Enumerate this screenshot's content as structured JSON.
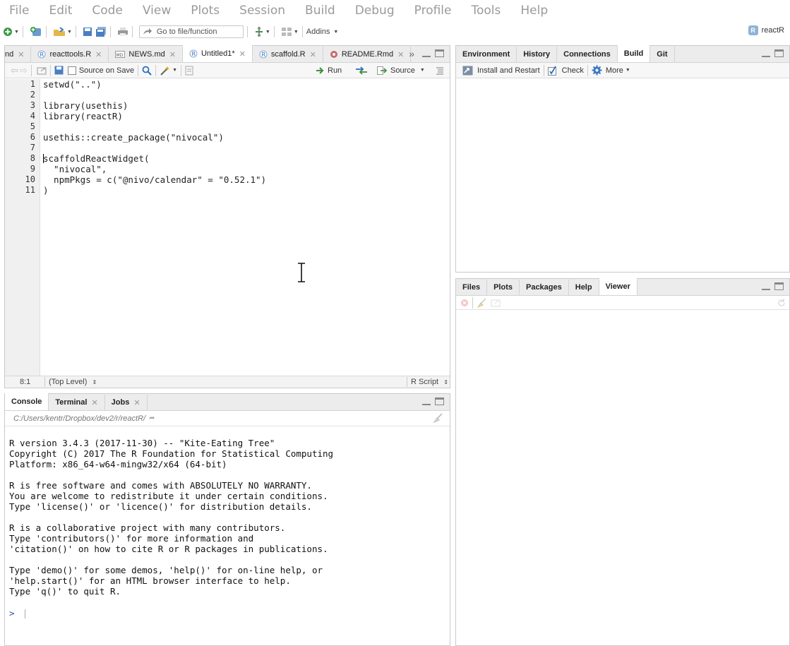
{
  "menu": [
    "File",
    "Edit",
    "Code",
    "View",
    "Plots",
    "Session",
    "Build",
    "Debug",
    "Profile",
    "Tools",
    "Help"
  ],
  "toolbar": {
    "goto_placeholder": "Go to file/function",
    "addins_label": "Addins",
    "project_label": "reactR",
    "project_icon": "R"
  },
  "source": {
    "tabs": [
      {
        "label": "nd",
        "closable": true,
        "active": false
      },
      {
        "label": "reacttools.R",
        "closable": true,
        "active": false
      },
      {
        "label": "NEWS.md",
        "closable": true,
        "active": false
      },
      {
        "label": "Untitled1*",
        "closable": true,
        "active": true
      },
      {
        "label": "scaffold.R",
        "closable": true,
        "active": false
      },
      {
        "label": "README.Rmd",
        "closable": true,
        "active": false
      }
    ],
    "source_on_save_label": "Source on Save",
    "run_label": "Run",
    "source_label": "Source",
    "line_numbers": [
      "1",
      "2",
      "3",
      "4",
      "5",
      "6",
      "7",
      "8",
      "9",
      "10",
      "11"
    ],
    "code_lines": [
      "setwd(\"..\")",
      "",
      "library(usethis)",
      "library(reactR)",
      "",
      "usethis::create_package(\"nivocal\")",
      "",
      "scaffoldReactWidget(",
      "  \"nivocal\",",
      "  npmPkgs = c(\"@nivo/calendar\" = \"0.52.1\")",
      ")"
    ],
    "status_position": "8:1",
    "status_scope": "(Top Level)",
    "status_filetype": "R Script"
  },
  "console": {
    "tabs": [
      {
        "label": "Console",
        "closable": false,
        "active": true
      },
      {
        "label": "Terminal",
        "closable": true,
        "active": false
      },
      {
        "label": "Jobs",
        "closable": true,
        "active": false
      }
    ],
    "path": "C:/Users/kentr/Dropbox/dev2/r/reactR/",
    "output": [
      "R version 3.4.3 (2017-11-30) -- \"Kite-Eating Tree\"",
      "Copyright (C) 2017 The R Foundation for Statistical Computing",
      "Platform: x86_64-w64-mingw32/x64 (64-bit)",
      "",
      "R is free software and comes with ABSOLUTELY NO WARRANTY.",
      "You are welcome to redistribute it under certain conditions.",
      "Type 'license()' or 'licence()' for distribution details.",
      "",
      "R is a collaborative project with many contributors.",
      "Type 'contributors()' for more information and",
      "'citation()' on how to cite R or R packages in publications.",
      "",
      "Type 'demo()' for some demos, 'help()' for on-line help, or",
      "'help.start()' for an HTML browser interface to help.",
      "Type 'q()' to quit R."
    ],
    "prompt": ">"
  },
  "env_pane": {
    "tabs": [
      {
        "label": "Environment",
        "active": false
      },
      {
        "label": "History",
        "active": false
      },
      {
        "label": "Connections",
        "active": false
      },
      {
        "label": "Build",
        "active": true
      },
      {
        "label": "Git",
        "active": false
      }
    ],
    "install_label": "Install and Restart",
    "check_label": "Check",
    "more_label": "More"
  },
  "files_pane": {
    "tabs": [
      {
        "label": "Files",
        "active": false
      },
      {
        "label": "Plots",
        "active": false
      },
      {
        "label": "Packages",
        "active": false
      },
      {
        "label": "Help",
        "active": false
      },
      {
        "label": "Viewer",
        "active": true
      }
    ]
  },
  "colors": {
    "accent_blue": "#2a6ebb",
    "run_green": "#3c8d3c",
    "string_green": "#2e7d32",
    "keyword_blue": "#2a4d9c"
  }
}
